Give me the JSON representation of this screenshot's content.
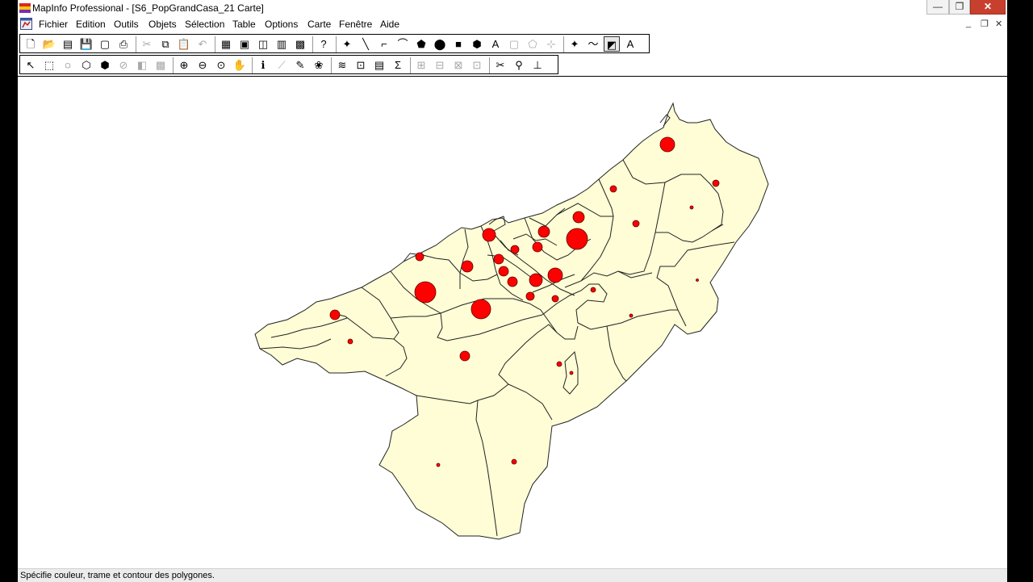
{
  "window": {
    "title": "MapInfo Professional - [S6_PopGrandCasa_21 Carte]",
    "minimize_glyph": "—",
    "maximize_glyph": "❐",
    "close_glyph": "✕",
    "mdi_minimize_glyph": "_",
    "mdi_restore_glyph": "❐",
    "mdi_close_glyph": "✕"
  },
  "menu": {
    "items": [
      "Fichier",
      "Edition",
      "Outils",
      "Objets",
      "Sélection",
      "Table",
      "Options",
      "Carte",
      "Fenêtre",
      "Aide"
    ]
  },
  "toolbar1": {
    "buttons": [
      {
        "name": "new-table-button",
        "glyph": "🗋"
      },
      {
        "name": "open-button",
        "glyph": "📂"
      },
      {
        "name": "open-workspace-button",
        "glyph": "▤"
      },
      {
        "name": "save-button",
        "glyph": "💾",
        "disabled": true
      },
      {
        "name": "save-copy-button",
        "glyph": "▢"
      },
      {
        "name": "print-button",
        "glyph": "⎙"
      },
      {
        "name": "cut-button",
        "glyph": "✂",
        "disabled": true
      },
      {
        "name": "copy-button",
        "glyph": "⧉"
      },
      {
        "name": "paste-button",
        "glyph": "📋",
        "disabled": true
      },
      {
        "name": "undo-button",
        "glyph": "↶",
        "disabled": true
      },
      {
        "name": "new-browser-button",
        "glyph": "▦"
      },
      {
        "name": "new-map-button",
        "glyph": "▣"
      },
      {
        "name": "new-graph-button",
        "glyph": "◫"
      },
      {
        "name": "new-layout-button",
        "glyph": "▥"
      },
      {
        "name": "redistrict-button",
        "glyph": "▩"
      },
      {
        "name": "help-button",
        "glyph": "?"
      },
      {
        "name": "symbol-tool",
        "glyph": "✦"
      },
      {
        "name": "line-tool",
        "glyph": "╲"
      },
      {
        "name": "polyline-tool",
        "glyph": "⌐"
      },
      {
        "name": "arc-tool",
        "glyph": "⌒"
      },
      {
        "name": "polygon-tool",
        "glyph": "⬟"
      },
      {
        "name": "ellipse-tool",
        "glyph": "⬤"
      },
      {
        "name": "rectangle-tool",
        "glyph": "■"
      },
      {
        "name": "rounded-rectangle-tool",
        "glyph": "⬢"
      },
      {
        "name": "text-tool",
        "glyph": "A"
      },
      {
        "name": "frame-tool",
        "glyph": "▢",
        "disabled": true
      },
      {
        "name": "reshape-tool",
        "glyph": "⬠",
        "disabled": true
      },
      {
        "name": "add-node-tool",
        "glyph": "⊹",
        "disabled": true
      },
      {
        "name": "symbol-style-button",
        "glyph": "✦"
      },
      {
        "name": "line-style-button",
        "glyph": "〜"
      },
      {
        "name": "region-style-button",
        "glyph": "◩",
        "selected": true
      },
      {
        "name": "text-style-button",
        "glyph": "A"
      }
    ]
  },
  "toolbar2": {
    "buttons": [
      {
        "name": "select-tool",
        "glyph": "↖"
      },
      {
        "name": "marquee-select-tool",
        "glyph": "⬚"
      },
      {
        "name": "radius-select-tool",
        "glyph": "◌"
      },
      {
        "name": "polygon-select-tool",
        "glyph": "⬡"
      },
      {
        "name": "boundary-select-tool",
        "glyph": "⬢"
      },
      {
        "name": "unselect-all-button",
        "glyph": "⊘",
        "disabled": true
      },
      {
        "name": "invert-selection-button",
        "glyph": "◧",
        "disabled": true
      },
      {
        "name": "graph-select-button",
        "glyph": "▩",
        "disabled": true
      },
      {
        "name": "zoom-in-tool",
        "glyph": "⊕"
      },
      {
        "name": "zoom-out-tool",
        "glyph": "⊖"
      },
      {
        "name": "change-view-button",
        "glyph": "⊙"
      },
      {
        "name": "grabber-tool",
        "glyph": "✋"
      },
      {
        "name": "info-tool",
        "glyph": "ℹ"
      },
      {
        "name": "hotlink-tool",
        "glyph": "⟋",
        "disabled": true
      },
      {
        "name": "label-tool",
        "glyph": "✎"
      },
      {
        "name": "drag-map-tool",
        "glyph": "❀"
      },
      {
        "name": "layer-control-button",
        "glyph": "≋"
      },
      {
        "name": "ruler-tool",
        "glyph": "⊡"
      },
      {
        "name": "legend-button",
        "glyph": "▤"
      },
      {
        "name": "statistics-button",
        "glyph": "Σ"
      },
      {
        "name": "setting-button-1",
        "glyph": "⊞",
        "disabled": true
      },
      {
        "name": "setting-button-2",
        "glyph": "⊟",
        "disabled": true
      },
      {
        "name": "setting-button-3",
        "glyph": "⊠",
        "disabled": true
      },
      {
        "name": "setting-button-4",
        "glyph": "⊡",
        "disabled": true
      },
      {
        "name": "clip-region-button",
        "glyph": "✂"
      },
      {
        "name": "drag-window-tool",
        "glyph": "⚲"
      },
      {
        "name": "scale-bar-button",
        "glyph": "⊥"
      }
    ]
  },
  "map": {
    "region_fill": "#fefdd6",
    "region_stroke": "#222222",
    "symbol_fill": "#ff0000",
    "symbol_stroke": "#5a0000"
  },
  "status": {
    "text": "Spécifie couleur, trame et contour des polygones."
  }
}
